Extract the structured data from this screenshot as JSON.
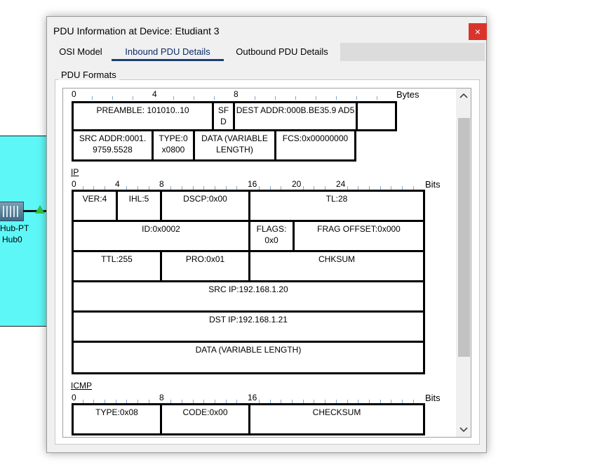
{
  "background": {
    "device_label_line1": "Hub-PT",
    "device_label_line2": "Hub0",
    "canvas_color": "#5ef7f7"
  },
  "dialog": {
    "title": "PDU Information at Device: Etudiant 3",
    "close_label": "×",
    "tabs": [
      {
        "label": "OSI Model"
      },
      {
        "label": "Inbound PDU Details"
      },
      {
        "label": "Outbound PDU Details"
      }
    ],
    "active_tab": "Inbound PDU Details",
    "group_title": "PDU Formats"
  },
  "ethernet": {
    "ruler_numbers": [
      "0",
      "4",
      "8"
    ],
    "unit": "Bytes",
    "fields": [
      "PREAMBLE: 101010..10",
      "SF D",
      "DEST ADDR:000B.BE35.9 AD5",
      "",
      "SRC ADDR:0001. 9759.5528",
      "TYPE:0 x0800",
      "DATA (VARIABLE LENGTH)",
      "FCS:0x00000000"
    ]
  },
  "ip": {
    "label": "IP",
    "ruler_numbers": [
      "0",
      "4",
      "8",
      "16",
      "20",
      "24"
    ],
    "unit": "Bits",
    "fields": [
      "VER:4",
      "IHL:5",
      "DSCP:0x00",
      "TL:28",
      "ID:0x0002",
      "FLAGS: 0x0",
      "FRAG OFFSET:0x000",
      "TTL:255",
      "PRO:0x01",
      "CHKSUM",
      "SRC IP:192.168.1.20",
      "DST IP:192.168.1.21",
      "DATA (VARIABLE LENGTH)"
    ]
  },
  "icmp": {
    "label": "ICMP",
    "ruler_numbers": [
      "0",
      "8",
      "16"
    ],
    "unit": "Bits",
    "fields": [
      "TYPE:0x08",
      "CODE:0x00",
      "CHECKSUM"
    ]
  },
  "scroll": {
    "up": "^",
    "down": "v"
  }
}
